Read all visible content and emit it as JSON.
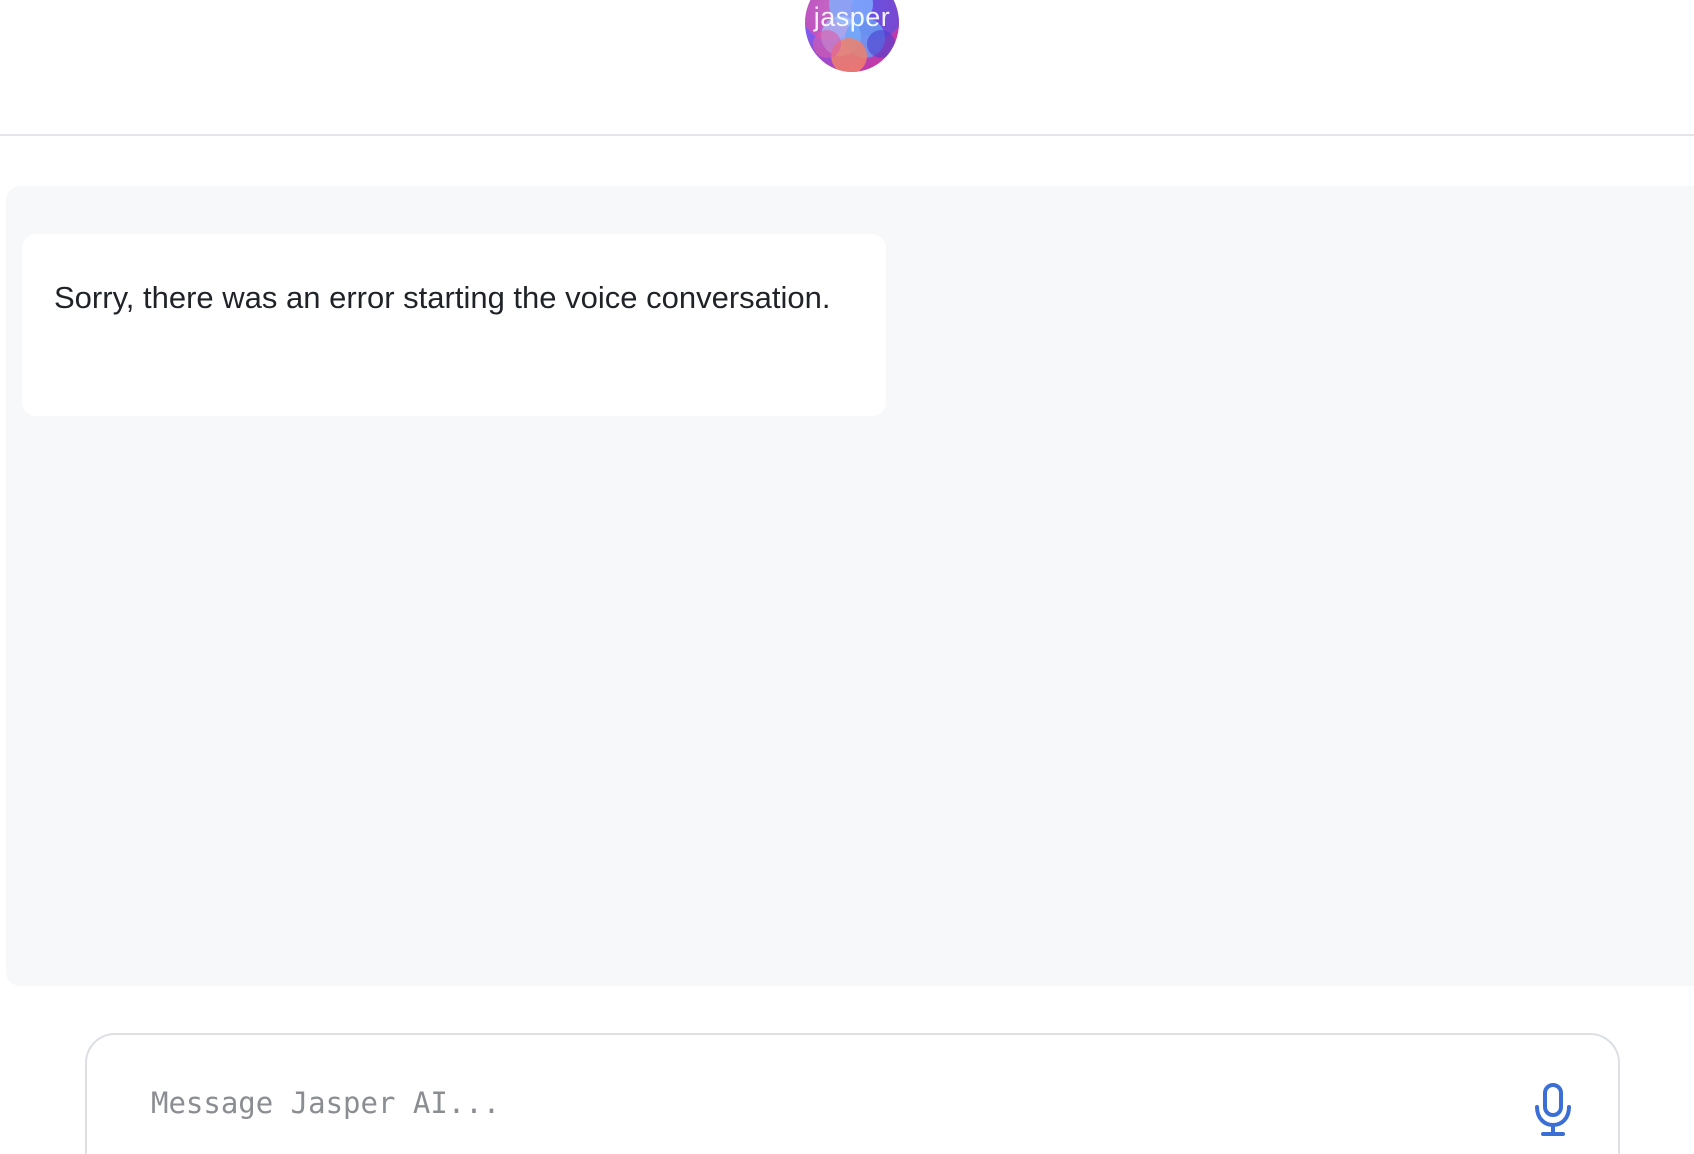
{
  "header": {
    "logo_text": "jasper"
  },
  "chat": {
    "messages": [
      {
        "role": "assistant",
        "text": "Sorry, there was an error starting the voice conversation."
      }
    ]
  },
  "composer": {
    "placeholder": "Message Jasper AI...",
    "value": "",
    "mic_icon": "microphone-icon"
  },
  "colors": {
    "accent": "#3b6fd6",
    "chat_background": "#f7f8fa",
    "text": "#1f2328"
  }
}
